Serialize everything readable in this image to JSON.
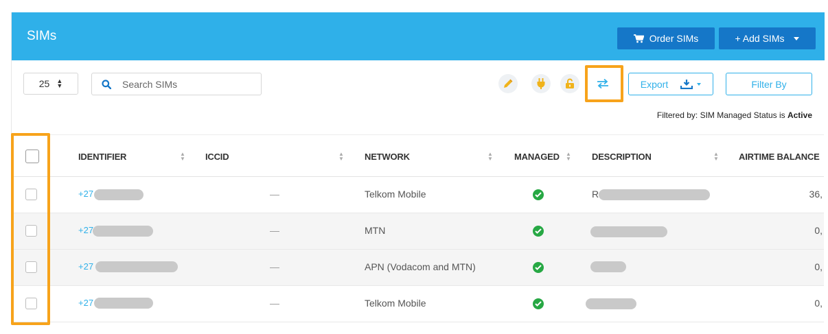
{
  "header": {
    "title": "SIMs",
    "order_label": "Order SIMs",
    "add_label": "+ Add SIMs"
  },
  "toolbar": {
    "page_size": "25",
    "search_placeholder": "Search SIMs",
    "export_label": "Export",
    "filter_label": "Filter By",
    "filtered_prefix": "Filtered by: SIM Managed Status is ",
    "filtered_value": "Active",
    "icons": [
      "pencil-icon",
      "plug-icon",
      "unlock-icon",
      "swap-icon"
    ]
  },
  "table": {
    "columns": [
      "IDENTIFIER",
      "ICCID",
      "NETWORK",
      "MANAGED",
      "DESCRIPTION",
      "AIRTIME BALANCE"
    ],
    "rows": [
      {
        "identifier": "+27",
        "iccid": "—",
        "network": "Telkom Mobile",
        "managed": true,
        "description": "R",
        "airtime": "36,"
      },
      {
        "identifier": "+27",
        "iccid": "—",
        "network": "MTN",
        "managed": true,
        "description": "",
        "airtime": "0,"
      },
      {
        "identifier": "+27",
        "iccid": "—",
        "network": "APN (Vodacom and MTN)",
        "managed": true,
        "description": "",
        "airtime": "0,"
      },
      {
        "identifier": "+27",
        "iccid": "—",
        "network": "Telkom Mobile",
        "managed": true,
        "description": "",
        "airtime": "0,"
      }
    ]
  },
  "colors": {
    "header_bg": "#2fb0e9",
    "button_dark": "#1577c8",
    "highlight": "#f7a31b",
    "success": "#27a844"
  }
}
